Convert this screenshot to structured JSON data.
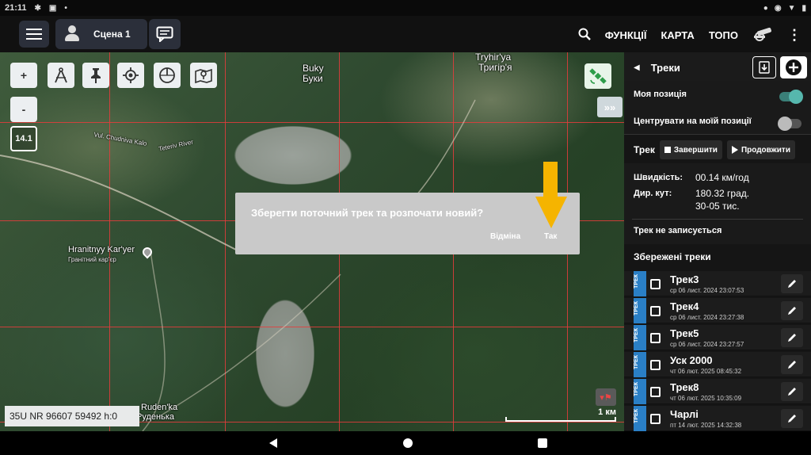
{
  "status_bar": {
    "time": "21:11"
  },
  "app_bar": {
    "scene_label": "Сцена 1",
    "menu": {
      "functions": "ФУНКЦІЇ",
      "map": "КАРТА",
      "topo": "ТОПО"
    },
    "icons": [
      "menu-icon",
      "person-icon",
      "chat-icon",
      "search-icon",
      "cannon-icon",
      "more-vert-icon"
    ]
  },
  "map": {
    "zoom_plus": "+",
    "zoom_minus": "-",
    "zoom_level": "14.1",
    "labels": {
      "buky_lat": "Buky",
      "buky_cyr": "Буки",
      "tryhirya_lat": "Tryhir'ya",
      "tryhirya_cyr": "Тригір'я",
      "granite_lat": "Hranitnyy Kar'yer",
      "granite_cyr": "Гранітний кар'єр",
      "rudenka_lat": "Ruden'ka",
      "rudenka_cyr": "Руденька",
      "chudniva": "Vul. Chudniva Kalo",
      "teteriv": "Teteriv River"
    },
    "coords": "35U NR 96607 59492 h:0",
    "scale": "1 км",
    "expand_label": "»»",
    "record_flag": "▾⚑"
  },
  "dialog": {
    "message": "Зберегти поточний трек та розпочати новий?",
    "cancel": "Відміна",
    "ok": "Так",
    "arrow_color": "#f5b400"
  },
  "panel": {
    "title": "Треки",
    "my_position": {
      "label": "Моя позиція",
      "on": true
    },
    "center_position": {
      "label": "Центрувати на моїй позиції",
      "on": false
    },
    "track_label": "Трек",
    "finish_label": "Завершити",
    "continue_label": "Продовжити",
    "speed_key": "Швидкість:",
    "speed_value": "00.14 км/год",
    "dir_key": "Дир. кут:",
    "dir_value_1": "180.32 град.",
    "dir_value_2": "30-05 тис.",
    "not_recording": "Трек не записується",
    "saved_title": "Збережені треки",
    "tag_label": "ТРЕК",
    "tracks": [
      {
        "name": "Трек3",
        "date": "ср 06 лист. 2024 23:07:53"
      },
      {
        "name": "Трек4",
        "date": "ср 06 лист. 2024 23:27:38"
      },
      {
        "name": "Трек5",
        "date": "ср 06 лист. 2024 23:27:57"
      },
      {
        "name": "Уск 2000",
        "date": "чт 06 лют. 2025 08:45:32"
      },
      {
        "name": "Трек8",
        "date": "чт 06 лют. 2025 10:35:09"
      },
      {
        "name": "Чарлі",
        "date": "пт 14 лют. 2025 14:32:38"
      }
    ]
  },
  "colors": {
    "accent_toggle": "#56b7ad",
    "tag_blue": "#2a7fc6",
    "grid_red": "#e63c3c"
  }
}
